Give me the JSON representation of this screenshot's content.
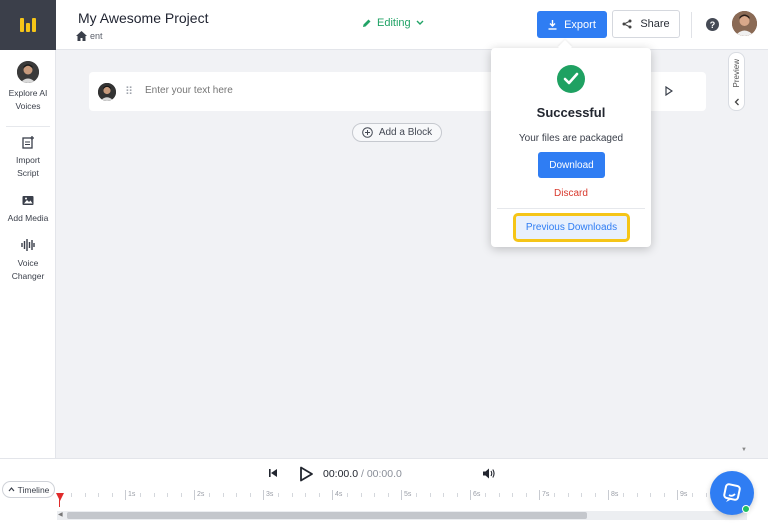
{
  "header": {
    "project_title": "My Awesome Project",
    "breadcrumb": "ent",
    "mode_label": "Editing",
    "export_label": "Export",
    "share_label": "Share",
    "help_glyph": "?"
  },
  "sidebar": {
    "items": [
      {
        "label": "Explore AI Voices",
        "icon": "avatar"
      },
      {
        "label": "Import Script",
        "icon": "import-script-icon"
      },
      {
        "label": "Add Media",
        "icon": "add-media-icon"
      },
      {
        "label": "Voice Changer",
        "icon": "voice-changer-icon"
      }
    ]
  },
  "editor": {
    "block_placeholder": "Enter your text here",
    "add_block_label": "Add a Block",
    "preview_label": "Preview"
  },
  "export_popup": {
    "title": "Successful",
    "message": "Your files are packaged",
    "download_label": "Download",
    "discard_label": "Discard",
    "previous_downloads_label": "Previous Downloads"
  },
  "player": {
    "current_time": "00:00.0",
    "separator": " / ",
    "duration": "00:00.0",
    "timeline_label": "Timeline"
  },
  "ruler_labels": [
    "1s",
    "2s",
    "3s",
    "4s",
    "5s",
    "6s",
    "7s",
    "8s",
    "9s"
  ],
  "colors": {
    "accent": "#2f7df3",
    "success": "#1fa162",
    "danger": "#d83a2e",
    "highlight": "#f5c518",
    "logo_bg": "#3b3f4a"
  }
}
